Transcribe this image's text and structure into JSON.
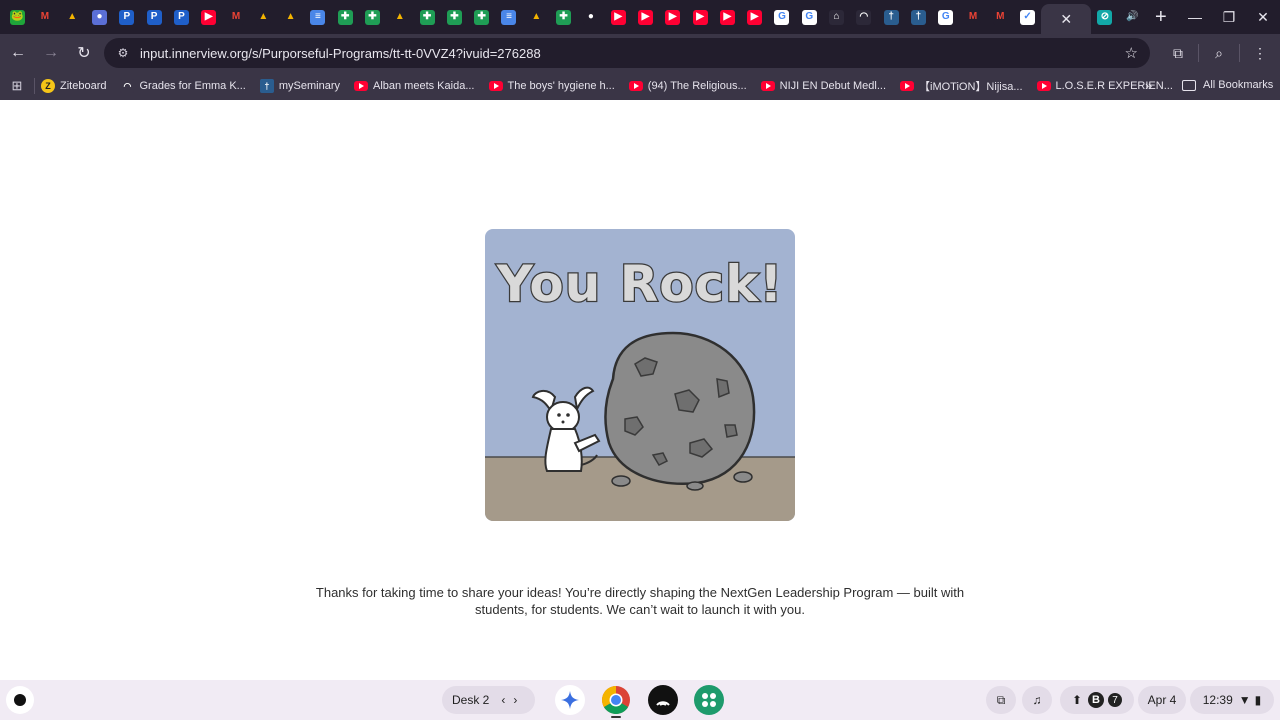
{
  "browser": {
    "tabs": [
      {
        "icon": "frog-icon",
        "color": "#1fa53a",
        "glyph": "🐸"
      },
      {
        "icon": "gmail-icon",
        "color": "#221d2c",
        "glyph": "M"
      },
      {
        "icon": "drive-icon",
        "color": "#221d2c",
        "glyph": "▲"
      },
      {
        "icon": "circle-app-icon",
        "color": "#5b6fd6",
        "glyph": "●"
      },
      {
        "icon": "p-icon",
        "color": "#1f5fc9",
        "glyph": "P"
      },
      {
        "icon": "p-icon",
        "color": "#1f5fc9",
        "glyph": "P"
      },
      {
        "icon": "p-icon",
        "color": "#1f5fc9",
        "glyph": "P"
      },
      {
        "icon": "youtube-icon",
        "color": "#ff0033",
        "glyph": "▶"
      },
      {
        "icon": "gmail-icon",
        "color": "#221d2c",
        "glyph": "M"
      },
      {
        "icon": "drive-icon",
        "color": "#221d2c",
        "glyph": "▲"
      },
      {
        "icon": "drive-icon",
        "color": "#221d2c",
        "glyph": "▲"
      },
      {
        "icon": "docs-icon",
        "color": "#4a86e8",
        "glyph": "≡"
      },
      {
        "icon": "sheets-icon",
        "color": "#1f9d55",
        "glyph": "✚"
      },
      {
        "icon": "sheets-icon",
        "color": "#1f9d55",
        "glyph": "✚"
      },
      {
        "icon": "drive-icon",
        "color": "#221d2c",
        "glyph": "▲"
      },
      {
        "icon": "sheets-icon",
        "color": "#1f9d55",
        "glyph": "✚"
      },
      {
        "icon": "sheets-icon",
        "color": "#1f9d55",
        "glyph": "✚"
      },
      {
        "icon": "sheets-icon",
        "color": "#1f9d55",
        "glyph": "✚"
      },
      {
        "icon": "docs-icon",
        "color": "#4a86e8",
        "glyph": "≡"
      },
      {
        "icon": "drive-icon",
        "color": "#221d2c",
        "glyph": "▲"
      },
      {
        "icon": "sheets-icon",
        "color": "#1f9d55",
        "glyph": "✚"
      },
      {
        "icon": "red-app-icon",
        "color": "#221d2c",
        "glyph": "●"
      },
      {
        "icon": "youtube-icon",
        "color": "#ff0033",
        "glyph": "▶"
      },
      {
        "icon": "youtube-icon",
        "color": "#ff0033",
        "glyph": "▶"
      },
      {
        "icon": "youtube-icon",
        "color": "#ff0033",
        "glyph": "▶"
      },
      {
        "icon": "youtube-icon",
        "color": "#ff0033",
        "glyph": "▶"
      },
      {
        "icon": "youtube-icon",
        "color": "#ff0033",
        "glyph": "▶"
      },
      {
        "icon": "youtube-icon",
        "color": "#ff0033",
        "glyph": "▶"
      },
      {
        "icon": "google-icon",
        "color": "#ffffff",
        "glyph": "G"
      },
      {
        "icon": "google-icon",
        "color": "#ffffff",
        "glyph": "G"
      },
      {
        "icon": "dark-app-icon",
        "color": "#2c2838",
        "glyph": "⌂"
      },
      {
        "icon": "dark-app-icon",
        "color": "#2c2838",
        "glyph": "◠"
      },
      {
        "icon": "seminary-icon",
        "color": "#2a5d8f",
        "glyph": "†"
      },
      {
        "icon": "seminary-icon",
        "color": "#2a5d8f",
        "glyph": "†"
      },
      {
        "icon": "google-icon",
        "color": "#ffffff",
        "glyph": "G"
      },
      {
        "icon": "gmail-icon",
        "color": "#221d2c",
        "glyph": "M"
      },
      {
        "icon": "gmail-icon",
        "color": "#221d2c",
        "glyph": "M"
      },
      {
        "icon": "innerview-icon",
        "color": "#ffffff",
        "glyph": "✓"
      }
    ],
    "after_active_tabs": [
      {
        "icon": "compass-icon",
        "color": "#12a8a8",
        "glyph": "⊘"
      },
      {
        "icon": "audio-icon",
        "color": "#221d2c",
        "glyph": "🔊"
      }
    ],
    "url": "input.innerview.org/s/Purporseful-Programs/tt-tt-0VVZ4?ivuid=276288"
  },
  "bookmarks": [
    {
      "label": "Ziteboard",
      "icon": "ziteboard-icon",
      "color": "#f5c518",
      "glyph": "Z"
    },
    {
      "label": "Grades for Emma K...",
      "icon": "grades-icon",
      "color": "#3a3546",
      "glyph": "◠"
    },
    {
      "label": "mySeminary",
      "icon": "seminary-icon",
      "color": "#2a5d8f",
      "glyph": "†"
    },
    {
      "label": "Alban meets Kaida...",
      "icon": "youtube-icon",
      "color": "",
      "glyph": ""
    },
    {
      "label": "The boys' hygiene h...",
      "icon": "youtube-icon",
      "color": "",
      "glyph": ""
    },
    {
      "label": "(94) The Religious...",
      "icon": "youtube-icon",
      "color": "",
      "glyph": ""
    },
    {
      "label": "NIJI EN Debut Medl...",
      "icon": "youtube-icon",
      "color": "",
      "glyph": ""
    },
    {
      "label": "【iMOTiON】Nijisa...",
      "icon": "youtube-icon",
      "color": "",
      "glyph": ""
    },
    {
      "label": "L.O.S.E.R EXPERIEN...",
      "icon": "youtube-icon",
      "color": "",
      "glyph": ""
    }
  ],
  "all_bookmarks_label": "All Bookmarks",
  "page": {
    "image_title": "You Rock!",
    "message_line1": "Thanks for taking  time to share your ideas! You’re directly shaping the NextGen Leadership Program — built with",
    "message_line2": "students, for students. We can’t wait to launch it with you."
  },
  "shelf": {
    "desk_label": "Desk 2",
    "date": "Apr 4",
    "time": "12:39",
    "notification_badge": "7",
    "tray_b": "B"
  }
}
